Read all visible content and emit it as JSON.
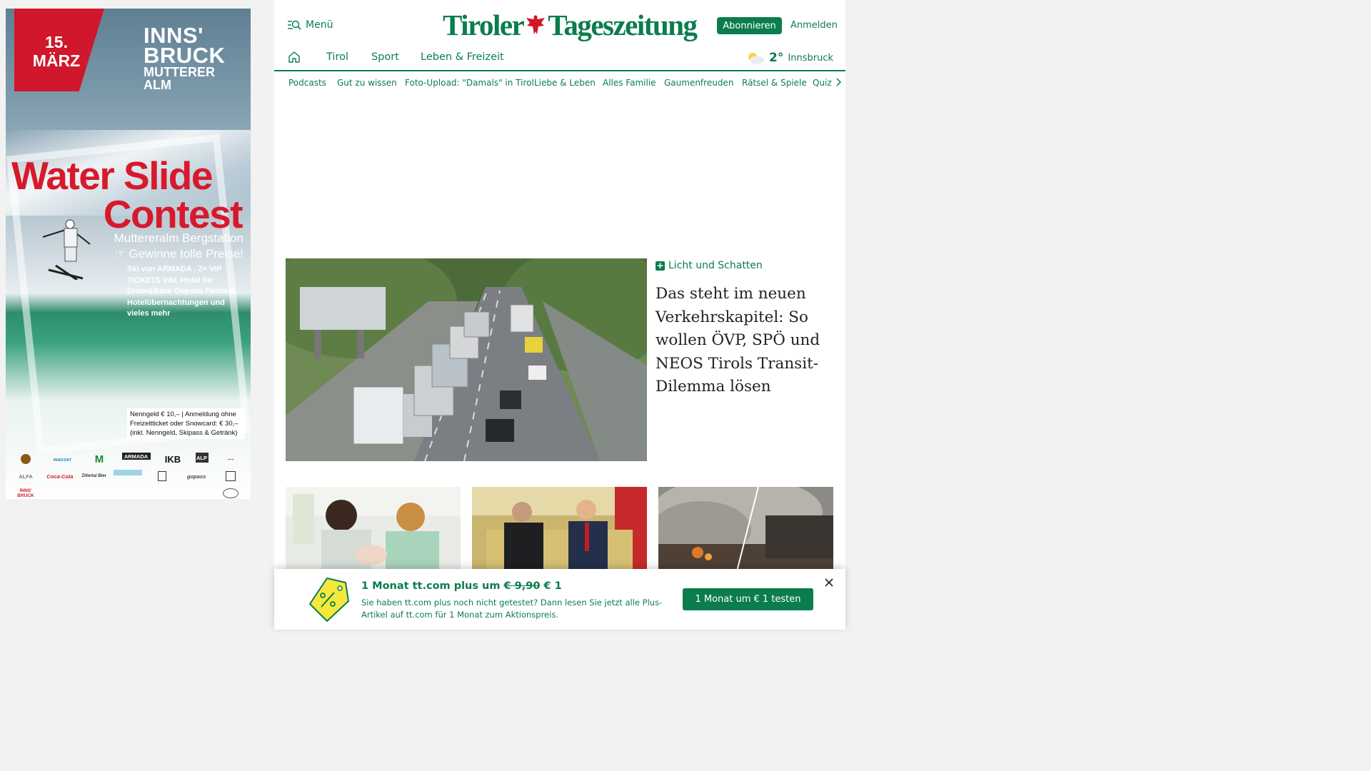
{
  "ad": {
    "date_line1": "15.",
    "date_line2": "MÄRZ",
    "city_line1": "INNS'",
    "city_line2": "BRUCK",
    "city_line3": "MUTTERER",
    "city_line4": "ALM",
    "title_line1": "Water Slide",
    "title_line2": "Contest",
    "location": "Muttereralm Bergstation",
    "prize_headline": "Gewinne tolle Preise!",
    "prize_details": "Ski von ARMADA , 2× VIP TICKETS inkl. Hotel für Drum&Base Gopass Festival, Hotelübernachtungen und vieles mehr",
    "fee_text": "Nenngeld € 10,– | Anmeldung ohne Freizeitticket oder Snowcard: € 30,– (inkl. Nenngeld, Skipass & Getränk)",
    "sponsors": [
      "",
      "wasser",
      "",
      "ARMADA",
      "IKB",
      "ALP",
      "",
      "ALFA",
      "Coca-Cola",
      "Zillertal Bier",
      "",
      "",
      "gopass",
      "",
      "INNS' BRUCK",
      ""
    ]
  },
  "header": {
    "menu_label": "Menü",
    "logo_left": "Tiroler",
    "logo_right": "Tageszeitung",
    "subscribe_label": "Abonnieren",
    "login_label": "Anmelden"
  },
  "nav": {
    "items": [
      "Tirol",
      "Sport",
      "Leben & Freizeit"
    ],
    "weather_temp": "2°",
    "weather_city": "Innsbruck"
  },
  "subnav": {
    "items": [
      "Podcasts",
      "Gut zu wissen",
      "Foto-Upload: \"Damals\" in Tirol",
      "Liebe & Leben",
      "Alles Familie",
      "Gaumenfreuden",
      "Rätsel & Spiele",
      "Quiz"
    ]
  },
  "lead": {
    "kicker": "Licht und Schatten",
    "title": "Das steht im neuen Verkehrskapitel: So wollen ÖVP, SPÖ und NEOS Tirols Transit-Dilemma lösen"
  },
  "promo": {
    "headline_prefix": "1 Monat tt.com plus um",
    "old_price": "€ 9,90",
    "new_price": "€ 1",
    "text": "Sie haben tt.com plus noch nicht getestet? Dann lesen Sie jetzt alle Plus-Artikel auf tt.com für 1 Monat zum Aktionspreis.",
    "cta_label": "1 Monat um € 1 testen"
  },
  "colors": {
    "brand_green": "#0b7d4c",
    "ad_red": "#d0172b"
  }
}
